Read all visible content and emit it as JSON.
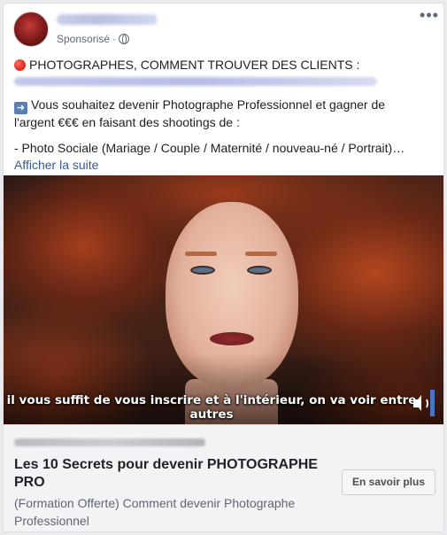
{
  "header": {
    "sponsored_label": "Sponsorisé",
    "separator": " · ",
    "more_label": "•••"
  },
  "post": {
    "line1": "PHOTOGRAPHES, COMMENT TROUVER DES CLIENTS :",
    "line2": "Vous souhaitez devenir Photographe Professionnel et gagner de",
    "line3": "l'argent €€€ en faisant des shootings de :",
    "line4": "- Photo Sociale (Mariage / Couple / Maternité / nouveau-né / Portrait)…",
    "see_more": "Afficher la suite"
  },
  "video": {
    "caption": "il vous suffit de vous inscrire et à l'intérieur, on va voir entre autres"
  },
  "footer": {
    "headline_line1": "Les 10 Secrets pour devenir PHOTOGRAPHE",
    "headline_line2": "PRO",
    "desc_line1": "(Formation Offerte) Comment devenir Photographe",
    "desc_line2": "Professionnel",
    "cta_label": "En savoir plus"
  },
  "colors": {
    "link": "#385898",
    "muted": "#606770",
    "footer_bg": "#f2f3f5",
    "volume_accent": "#4a74c9"
  },
  "icons": [
    "red-circle-icon",
    "right-arrow-icon",
    "globe-icon",
    "more-icon",
    "volume-icon"
  ]
}
